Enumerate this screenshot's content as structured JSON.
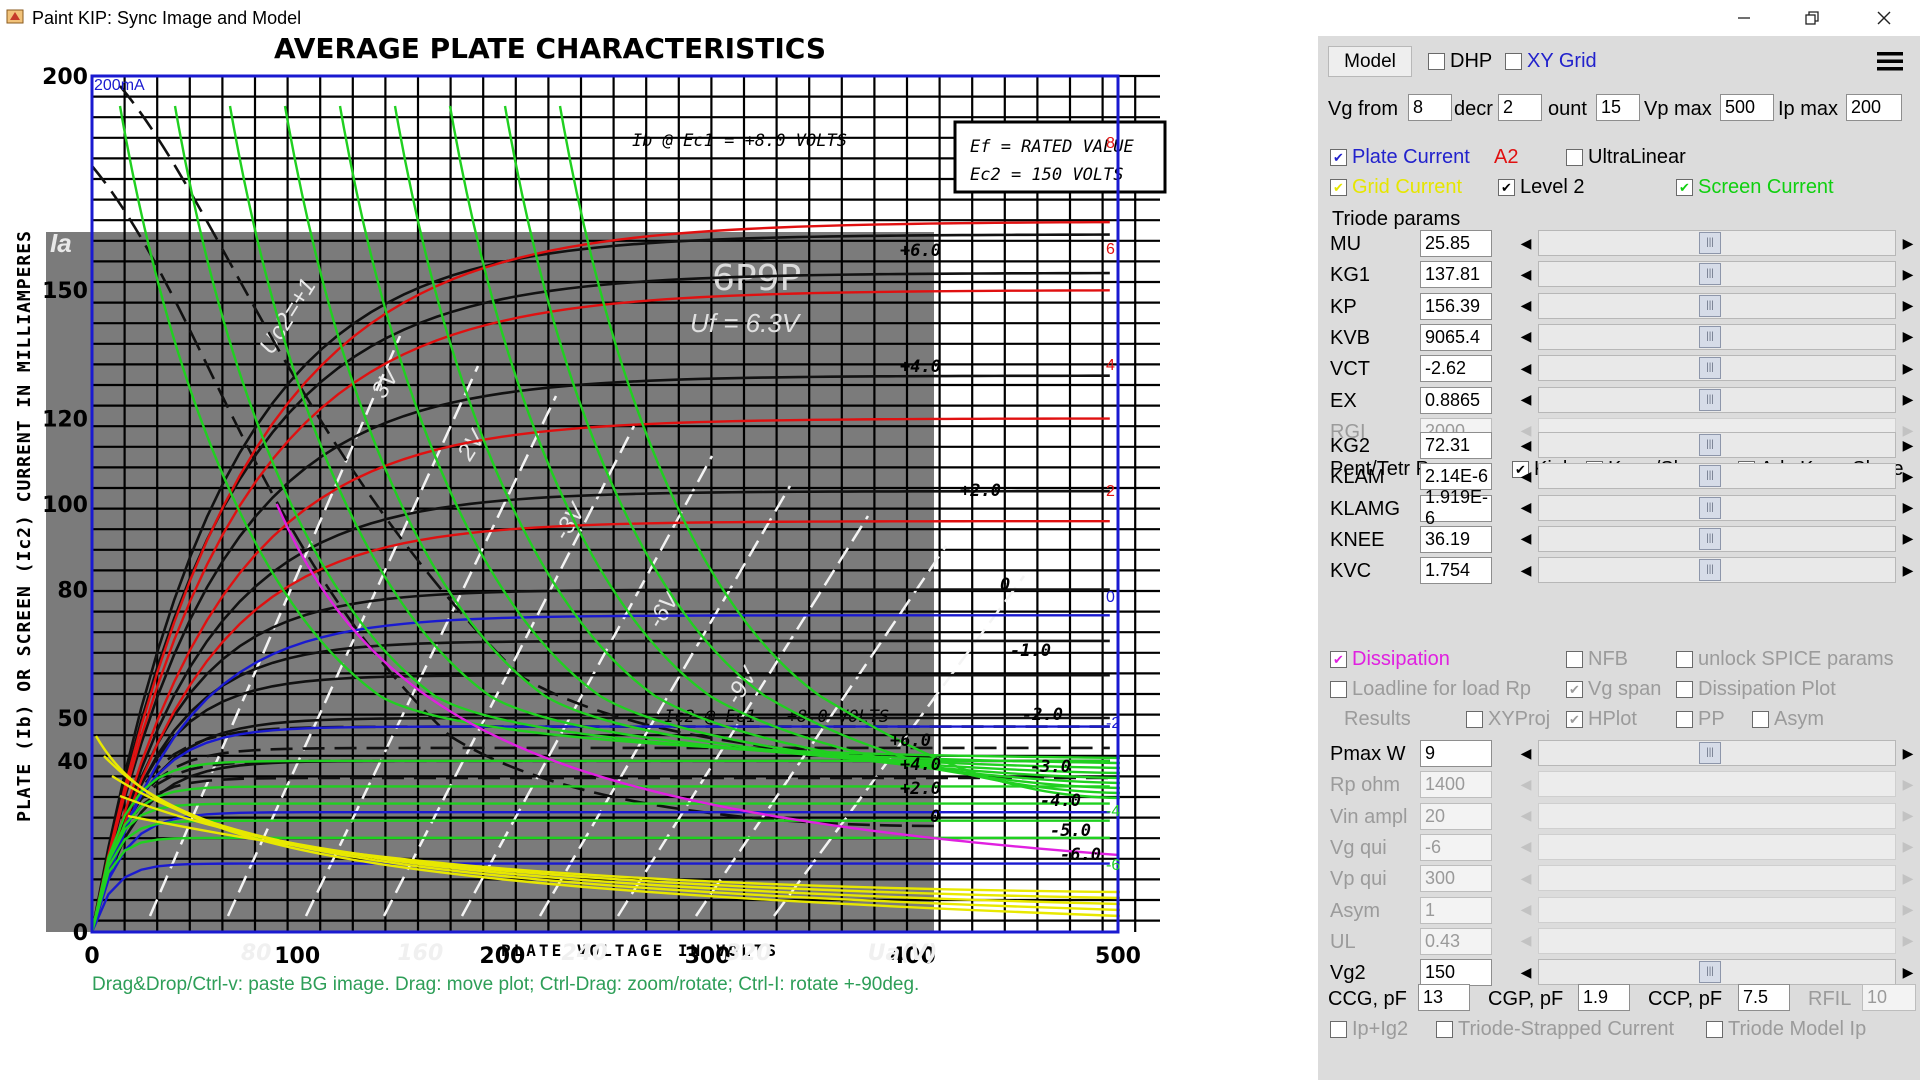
{
  "window": {
    "title": "Paint KIP: Sync Image and Model"
  },
  "chart": {
    "title": "AVERAGE PLATE CHARACTERISTICS",
    "tube": "6P9P",
    "heater": "Uf = 6.3V",
    "y_label": "PLATE (Ib) OR SCREEN (Ic2) CURRENT IN MILLIAMPERES",
    "x_label": "PLATE VOLTAGE IN VOLTS",
    "legend_line1": "Ef = RATED VALUE",
    "legend_line2": "Ec2 = 150 VOLTS",
    "plate_label": "Ib @ Ec1 = +8.0 VOLTS",
    "screen_label": "Ic2 @ Ec1 = +8.0 VOLTS",
    "overlay_max": "200mA",
    "y_ticks": [
      "200",
      "150",
      "120",
      "100",
      "80",
      "50",
      "40",
      "0"
    ],
    "x_ticks": [
      "0",
      "100",
      "200",
      "300",
      "400",
      "500"
    ],
    "x_ticks_scan": [
      "80",
      "160",
      "240",
      "320",
      "Ua(V)"
    ],
    "grid_labels": [
      "+6.0",
      "+4.0",
      "+2.0",
      "0",
      "-1.0",
      "-2.0",
      "+6.0",
      "+4.0",
      "+2.0",
      "0",
      "-3.0",
      "-4.0",
      "-5.0",
      "-6.0"
    ],
    "model_labels": [
      "8",
      "6",
      "4",
      "2",
      "0",
      "-2",
      "-4",
      "-6"
    ],
    "scan_labels": [
      "Ia",
      "Uc2=+1",
      "3V",
      "2V",
      "-3V",
      "-6V",
      "-9V"
    ]
  },
  "help_text": "Drag&Drop/Ctrl-v: paste BG image. Drag: move plot; Ctrl-Drag: zoom/rotate; Ctrl-I: rotate +-90deg.",
  "panel": {
    "model_button": "Model",
    "dhp": "DHP",
    "xy_grid": "XY Grid",
    "vg_from_label": "Vg from",
    "vg_from": "8",
    "decr_label": "decr",
    "decr": "2",
    "count_label": "ount",
    "count": "15",
    "vp_max_label": "Vp max",
    "vp_max": "500",
    "ip_max_label": "Ip max",
    "ip_max": "200",
    "plate_current": "Plate Current",
    "a2": "A2",
    "ultralinear": "UltraLinear",
    "grid_current": "Grid Current",
    "level2": "Level 2",
    "screen_current": "Screen Current",
    "triode_params": "Triode params",
    "triode": [
      {
        "label": "MU",
        "value": "25.85"
      },
      {
        "label": "KG1",
        "value": "137.81"
      },
      {
        "label": "KP",
        "value": "156.39"
      },
      {
        "label": "KVB",
        "value": "9065.4"
      },
      {
        "label": "VCT",
        "value": "-2.62"
      },
      {
        "label": "EX",
        "value": "0.8865"
      },
      {
        "label": "RGI",
        "value": "2000"
      }
    ],
    "pent_params": "Pent/Tetr Params",
    "kink": "Kink",
    "knee_slope": "Knee/Slope",
    "adv_knee": "Adv Knee,Slope",
    "pent": [
      {
        "label": "KG2",
        "value": "72.31"
      },
      {
        "label": "KLAM",
        "value": "2.14E-6"
      },
      {
        "label": "KLAMG",
        "value": "1.919E-6"
      },
      {
        "label": "KNEE",
        "value": "36.19"
      },
      {
        "label": "KVC",
        "value": "1.754"
      }
    ],
    "dissipation": "Dissipation",
    "nfb": "NFB",
    "unlock_spice": "unlock SPICE params",
    "loadline": "Loadline for load Rp",
    "vg_span": "Vg span",
    "dissipation_plot": "Dissipation Plot",
    "results": "Results",
    "xyproj": "XYProj",
    "hplot": "HPlot",
    "pp": "PP",
    "asym": "Asym",
    "load": [
      {
        "label": "Pmax W",
        "value": "9"
      },
      {
        "label": "Rp ohm",
        "value": "1400"
      },
      {
        "label": "Vin ampl",
        "value": "20"
      },
      {
        "label": "Vg qui",
        "value": "-6"
      },
      {
        "label": "Vp qui",
        "value": "300"
      },
      {
        "label": "Asym",
        "value": "1"
      },
      {
        "label": "UL",
        "value": "0.43"
      },
      {
        "label": "Vg2",
        "value": "150"
      }
    ],
    "ccg_label": "CCG, pF",
    "ccg": "13",
    "cgp_label": "CGP, pF",
    "cgp": "1.9",
    "ccp_label": "CCP, pF",
    "ccp": "7.5",
    "rfil_label": "RFIL",
    "rfil": "10",
    "ip_ig2": "Ip+Ig2",
    "triode_strapped": "Triode-Strapped Current",
    "triode_model_ip": "Triode Model Ip"
  },
  "colors": {
    "plate": "#e01010",
    "grid": "#e8e800",
    "screen": "#20d020",
    "model_axis": "#1a1ad0",
    "dissipation": "#e020e0",
    "help": "#2e9e58"
  }
}
